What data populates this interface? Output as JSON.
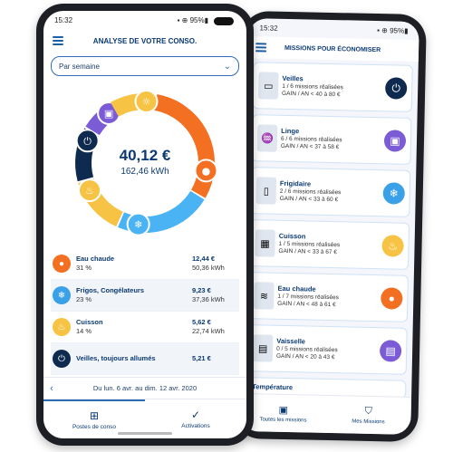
{
  "colors": {
    "navy": "#0b3a73",
    "accent_blue": "#2f6cb3",
    "orange": "#f36f21",
    "blue": "#3aa0e8",
    "yellow": "#f6c344",
    "purple": "#7b5cd6",
    "dark": "#0e2b4f",
    "sky": "#4ab3f4"
  },
  "back": {
    "status_time": "15:32",
    "status_icons": "▪ ⊕ 95%▮",
    "title": "MISSIONS POUR ÉCONOMISER",
    "missions": [
      {
        "name": "Veilles",
        "done": "1 / 6 missions réalisées",
        "gain": "GAIN / AN < 40 à 80 €",
        "thumb": "tv-icon",
        "icon": "power-icon",
        "color": "#0e2b4f"
      },
      {
        "name": "Linge",
        "done": "6 / 6 missions réalisées",
        "gain": "GAIN / AN < 37 à 58 €",
        "thumb": "laundry-icon",
        "icon": "washer-icon",
        "color": "#7b5cd6"
      },
      {
        "name": "Frigidaire",
        "done": "2 / 6 missions réalisées",
        "gain": "GAIN / AN < 33 à 60 €",
        "thumb": "fridge-icon",
        "icon": "snowflake-icon",
        "color": "#3aa0e8"
      },
      {
        "name": "Cuisson",
        "done": "1 / 5 missions réalisées",
        "gain": "GAIN / AN < 33 à 67 €",
        "thumb": "oven-icon",
        "icon": "flame-icon",
        "color": "#f6c344"
      },
      {
        "name": "Eau chaude",
        "done": "1 / 7 missions réalisées",
        "gain": "GAIN / AN < 48 à 61 €",
        "thumb": "water-icon",
        "icon": "drop-icon",
        "color": "#f36f21"
      },
      {
        "name": "Vaisselle",
        "done": "0 / 5 missions réalisées",
        "gain": "GAIN / AN < 20 à 43 €",
        "thumb": "dishwasher-icon",
        "icon": "dishwasher-icon",
        "color": "#7b5cd6"
      }
    ],
    "partial_item": "Température",
    "tabs": [
      "Toutes les missions",
      "Mes Missions"
    ]
  },
  "front": {
    "status_time": "15:32",
    "status_icons": "▪ ⊕ 95%▮",
    "title": "ANALYSE DE VOTRE CONSO.",
    "period_select": "Par semaine",
    "total_amount": "40,12 €",
    "total_kwh": "162,46 kWh",
    "categories": [
      {
        "name": "Eau chaude",
        "pct": "31 %",
        "eur": "12,44 €",
        "kwh": "50,36 kWh",
        "icon": "drop-icon",
        "color": "#f36f21"
      },
      {
        "name": "Frigos, Congélateurs",
        "pct": "23 %",
        "eur": "9,23 €",
        "kwh": "37,36 kWh",
        "icon": "snowflake-icon",
        "color": "#3aa0e8"
      },
      {
        "name": "Cuisson",
        "pct": "14 %",
        "eur": "5,62 €",
        "kwh": "22,74 kWh",
        "icon": "flame-icon",
        "color": "#f6c344"
      },
      {
        "name": "Veilles, toujours allumés",
        "pct": "",
        "eur": "5,21 €",
        "kwh": "",
        "icon": "power-icon",
        "color": "#0e2b4f"
      }
    ],
    "period_text": "Du lun. 6 avr. au dim. 12 avr. 2020",
    "tabs": [
      "Postes de conso",
      "Activations"
    ]
  },
  "chart_data": {
    "type": "pie",
    "categories": [
      "Eau chaude",
      "Frigos, Congélateurs",
      "Cuisson",
      "Veilles, toujours allumés",
      "Linge",
      "Éclairage"
    ],
    "values": [
      31,
      23,
      14,
      13,
      8,
      11
    ],
    "colors": [
      "#f36f21",
      "#4ab3f4",
      "#f6c344",
      "#0e2b4f",
      "#7b5cd6",
      "#f6c344"
    ],
    "title": "",
    "center_text": [
      "40,12 €",
      "162,46 kWh"
    ]
  }
}
